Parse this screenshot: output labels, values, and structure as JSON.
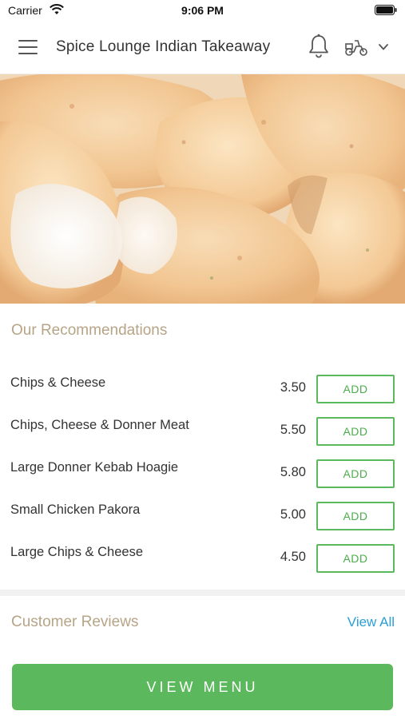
{
  "status_bar": {
    "carrier": "Carrier",
    "time": "9:06 PM"
  },
  "header": {
    "title": "Spice Lounge Indian Takeaway",
    "icons": [
      "menu-icon",
      "bell-icon",
      "scooter-icon",
      "chevron-down-icon"
    ]
  },
  "hero": {
    "image_subject": "fried chicken pakora"
  },
  "recommendations": {
    "title": "Our Recommendations",
    "items": [
      {
        "name": "Chips & Cheese",
        "price": "3.50",
        "add_label": "ADD"
      },
      {
        "name": "Chips, Cheese & Donner Meat",
        "price": "5.50",
        "add_label": "ADD"
      },
      {
        "name": "Large Donner Kebab Hoagie",
        "price": "5.80",
        "add_label": "ADD"
      },
      {
        "name": "Small Chicken Pakora",
        "price": "5.00",
        "add_label": "ADD"
      },
      {
        "name": "Large Chips & Cheese",
        "price": "4.50",
        "add_label": "ADD"
      }
    ]
  },
  "reviews": {
    "title": "Customer Reviews",
    "view_all": "View All"
  },
  "footer": {
    "view_menu": "VIEW MENU"
  },
  "colors": {
    "accent_green": "#5cb85c",
    "section_title": "#b7a486",
    "link_blue": "#2a9fd6"
  }
}
